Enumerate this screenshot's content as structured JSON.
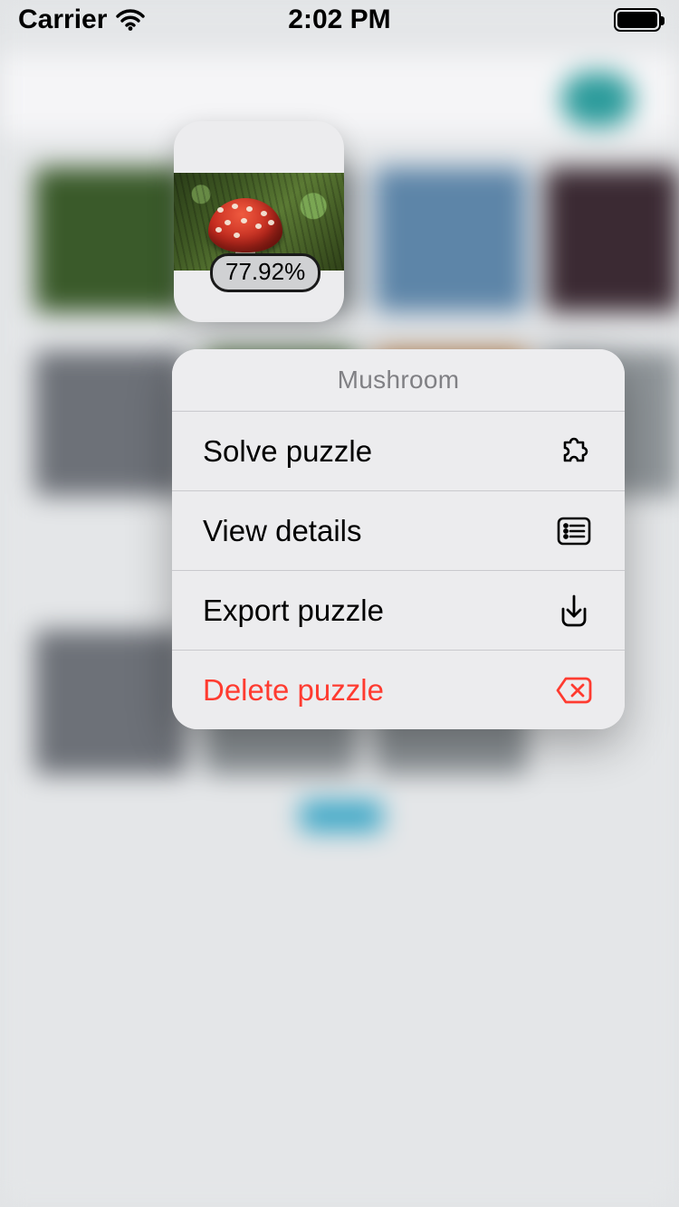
{
  "status_bar": {
    "carrier": "Carrier",
    "time": "2:02 PM"
  },
  "preview": {
    "progress_text": "77.92%"
  },
  "menu": {
    "title": "Mushroom",
    "solve_label": "Solve puzzle",
    "details_label": "View details",
    "export_label": "Export puzzle",
    "delete_label": "Delete puzzle"
  }
}
